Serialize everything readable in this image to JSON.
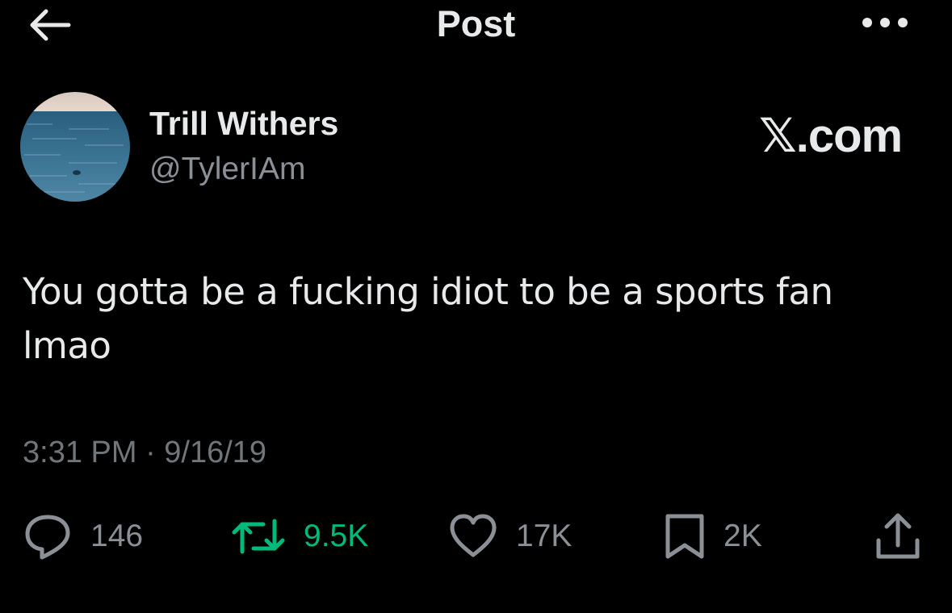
{
  "header": {
    "title": "Post",
    "back_icon": "arrow-left-icon",
    "more_icon": "more-horizontal-icon"
  },
  "author": {
    "display_name": "Trill Withers",
    "handle": "@TylerIAm",
    "avatar": "ocean-horizon-photo"
  },
  "watermark": "𝕏.com",
  "post": {
    "text_line1": "You gotta be a fucking idiot to be a sports fan",
    "text_line2": "lmao",
    "timestamp": "3:31 PM · 9/16/19"
  },
  "actions": {
    "replies": {
      "icon": "reply-icon",
      "count": "146"
    },
    "reposts": {
      "icon": "repost-icon",
      "count": "9.5K",
      "color": "#00ba7c"
    },
    "likes": {
      "icon": "heart-icon",
      "count": "17K"
    },
    "bookmarks": {
      "icon": "bookmark-icon",
      "count": "2K"
    },
    "share": {
      "icon": "share-icon"
    }
  },
  "colors": {
    "background": "#000000",
    "text_primary": "#e7e9ea",
    "text_secondary": "#71767b",
    "repost_active": "#00ba7c"
  }
}
